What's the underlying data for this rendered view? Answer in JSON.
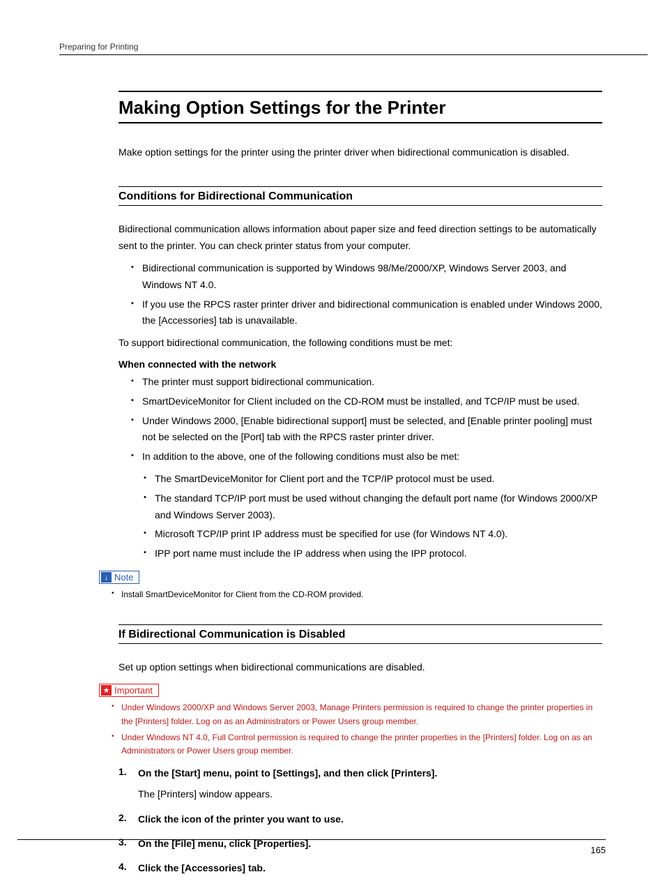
{
  "header": {
    "breadcrumb": "Preparing for Printing"
  },
  "title": "Making Option Settings for the Printer",
  "intro": "Make option settings for the printer using the printer driver when bidirectional communication is disabled.",
  "section1": {
    "title": "Conditions for Bidirectional Communication",
    "para1": "Bidirectional communication allows information about paper size and feed direction settings to be automatically sent to the printer. You can check printer status from your computer.",
    "bullets1": [
      "Bidirectional communication is supported by Windows 98/Me/2000/XP, Windows Server 2003, and Windows NT 4.0.",
      "If you use the RPCS raster printer driver and bidirectional communication is enabled under Windows 2000, the [Accessories] tab is unavailable."
    ],
    "para2": "To support bidirectional communication, the following conditions must be met:",
    "boldsub": "When connected with the network",
    "bullets2": [
      "The printer must support bidirectional communication.",
      "SmartDeviceMonitor for Client included on the CD-ROM must be installed, and TCP/IP must be used.",
      "Under Windows 2000, [Enable bidirectional support] must be selected, and [Enable printer pooling] must not be selected on the [Port] tab with the RPCS raster printer driver.",
      "In addition to the above, one of the following conditions must also be met:"
    ],
    "bullets3": [
      "The SmartDeviceMonitor for Client port and the TCP/IP protocol must be used.",
      "The standard TCP/IP port must be used without changing the default port name (for Windows 2000/XP and Windows Server 2003).",
      "Microsoft TCP/IP print IP address must be specified for use (for Windows NT 4.0).",
      "IPP port name must include the IP address when using the IPP protocol."
    ],
    "note_label": "Note",
    "note_items": [
      "Install SmartDeviceMonitor for Client from the CD-ROM provided."
    ]
  },
  "section2": {
    "title": "If Bidirectional Communication is Disabled",
    "para1": "Set up option settings when bidirectional communications are disabled.",
    "important_label": "Important",
    "important_items": [
      "Under Windows 2000/XP and Windows Server 2003, Manage Printers permission is required to change the printer properties in the [Printers] folder. Log on as an Administrators or Power Users group member.",
      "Under Windows NT 4.0, Full Control permission is required to change the printer properties in the [Printers] folder. Log on as an Administrators or Power Users group member."
    ],
    "steps": [
      {
        "head": "On the [Start] menu, point to [Settings], and then click [Printers].",
        "body": "The [Printers] window appears."
      },
      {
        "head": "Click the icon of the printer you want to use.",
        "body": ""
      },
      {
        "head": "On the [File] menu, click [Properties].",
        "body": ""
      },
      {
        "head": "Click the [Accessories] tab.",
        "body": ""
      }
    ]
  },
  "footer": {
    "page_number": "165"
  }
}
